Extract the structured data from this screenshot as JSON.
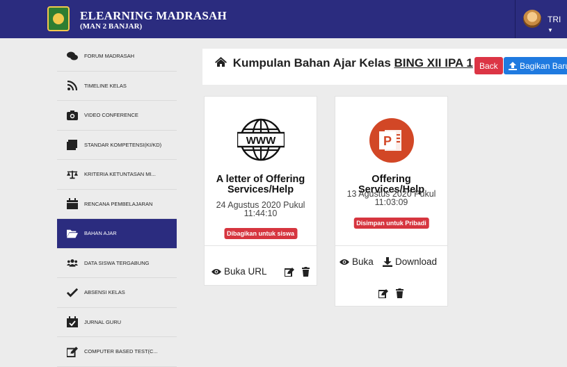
{
  "header": {
    "brand_title": "ELEARNING MADRASAH",
    "brand_subtitle": "(MAN 2 BANJAR)",
    "user_name": "TRI"
  },
  "sidebar": {
    "items": [
      {
        "label": "FORUM MADRASAH",
        "icon": "comments-icon"
      },
      {
        "label": "TIMELINE KELAS",
        "icon": "rss-icon"
      },
      {
        "label": "VIDEO CONFERENCE",
        "icon": "camera-icon"
      },
      {
        "label": "STANDAR KOMPETENSI(KI/KD)",
        "icon": "book-icon"
      },
      {
        "label": "KRITERIA KETUNTASAN MI...",
        "icon": "balance-scale-icon"
      },
      {
        "label": "RENCANA PEMBELAJARAN",
        "icon": "calendar-icon"
      },
      {
        "label": "BAHAN AJAR",
        "icon": "folder-open-icon",
        "active": true
      },
      {
        "label": "DATA SISWA TERGABUNG",
        "icon": "users-icon"
      },
      {
        "label": "ABSENSI KELAS",
        "icon": "check-icon"
      },
      {
        "label": "JURNAL GURU",
        "icon": "calendar-check-icon"
      },
      {
        "label": "COMPUTER BASED TEST(C...",
        "icon": "edit-icon"
      }
    ]
  },
  "main": {
    "title_prefix": "Kumpulan Bahan Ajar Kelas",
    "class_name": "BING XII IPA 1",
    "back_label": "Back",
    "share_label": "Bagikan Baru"
  },
  "cards": [
    {
      "title": "A letter of Offering Services/Help",
      "date": "24 Agustus 2020 Pukul 11:44:10",
      "badge": "Dibagikan untuk siswa",
      "icon": "www-globe-icon",
      "actions": {
        "open_label": "Buka URL"
      }
    },
    {
      "title": "Offering Services/Help",
      "date": "13 Agustus 2020 Pukul 11:03:09",
      "badge": "Disimpan untuk Pribadi",
      "icon": "powerpoint-icon",
      "actions": {
        "open_label": "Buka",
        "download_label": "Download"
      }
    }
  ],
  "colors": {
    "primary": "#2b2c7f",
    "danger": "#dc3545",
    "info": "#1f7ae0",
    "badge": "#d6353f",
    "powerpoint": "#d24726"
  }
}
